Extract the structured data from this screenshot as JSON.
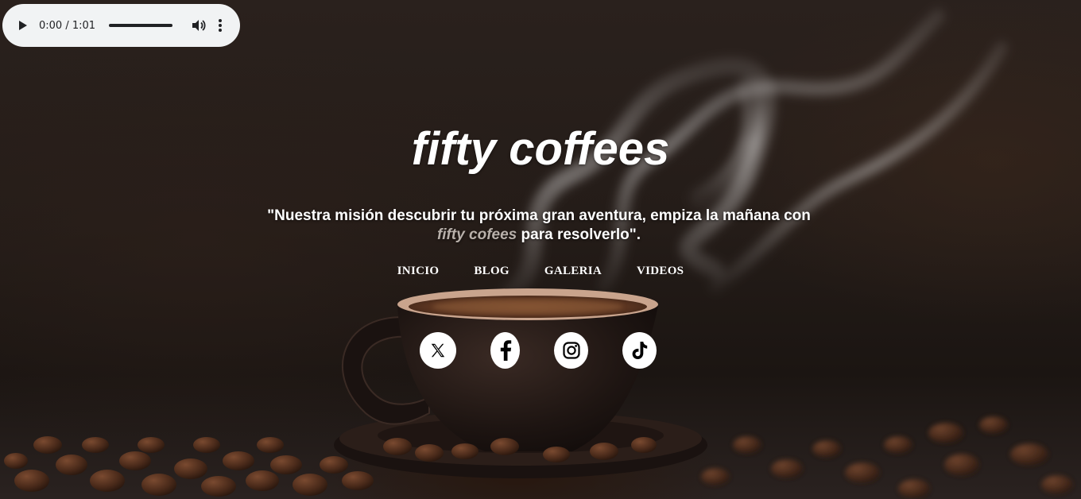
{
  "audio": {
    "time": "0:00 / 1:01",
    "progress": 0
  },
  "hero": {
    "title": "fifty coffees",
    "tagline_part1": "\"Nuestra misión descubrir tu próxima gran aventura, empiza la mañana con ",
    "tagline_brand": "fifty cofees",
    "tagline_part2": " para resolverlo\"."
  },
  "nav": {
    "items": [
      {
        "label": "INICIO"
      },
      {
        "label": "BLOG"
      },
      {
        "label": "GALERIA"
      },
      {
        "label": "VIDEOS"
      }
    ]
  },
  "social": {
    "icons": [
      "x-icon",
      "facebook-icon",
      "instagram-icon",
      "tiktok-icon"
    ]
  },
  "colors": {
    "text": "#ffffff",
    "brand_accent": "#b8b0aa",
    "player_bg": "#f1f3f4"
  }
}
